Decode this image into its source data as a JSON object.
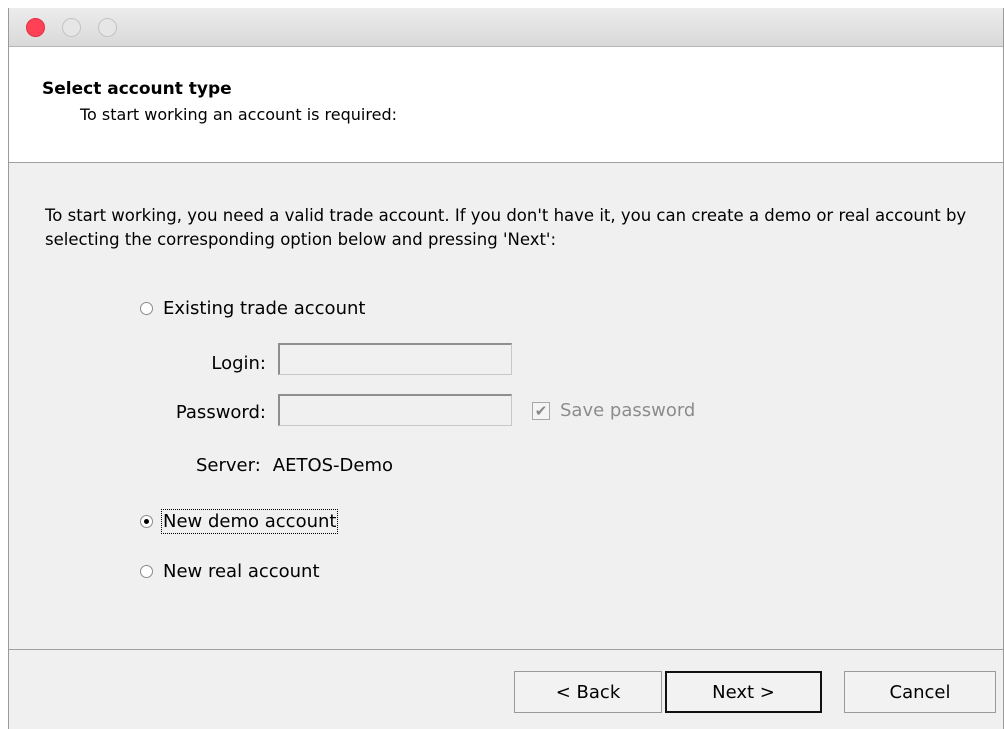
{
  "header": {
    "title": "Select account type",
    "subtitle": "To start working an account is required:"
  },
  "intro": "To start working, you need a valid trade account. If you don't have it, you can create a demo or real account by selecting the corresponding option below and pressing 'Next':",
  "options": {
    "existing": {
      "label": "Existing trade account",
      "selected": false
    },
    "demo": {
      "label": "New demo account",
      "selected": true
    },
    "real": {
      "label": "New real account",
      "selected": false
    }
  },
  "fields": {
    "login_label": "Login:",
    "login_value": "",
    "password_label": "Password:",
    "password_value": "",
    "save_password_label": "Save password",
    "save_password_checked": true,
    "server_label": "Server:",
    "server_value": "AETOS-Demo"
  },
  "buttons": {
    "back": "< Back",
    "next": "Next >",
    "cancel": "Cancel"
  },
  "colors": {
    "close": "#fe4157",
    "window_bg": "#f0f0f0"
  },
  "icons": [
    "close-icon",
    "minimize-icon",
    "maximize-icon",
    "radio-icon",
    "checkbox-icon"
  ]
}
